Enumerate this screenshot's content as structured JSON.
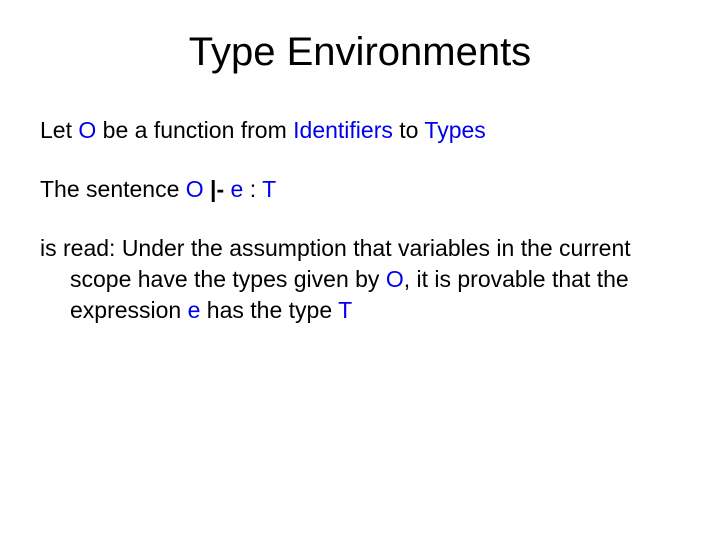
{
  "title": "Type Environments",
  "line1": {
    "t1": "Let ",
    "O": "O",
    "t2": " be a function from ",
    "ident": "Identifiers",
    "t3": " to ",
    "types": "Types"
  },
  "line2": {
    "t1": "The sentence ",
    "O": "O",
    "turnstile": " |- ",
    "e": "e",
    "colon": " : ",
    "T": "T"
  },
  "line3": {
    "t1": "is read: Under the assumption that variables in the current scope have the types given by ",
    "O": "O",
    "t2": ", it is provable that the expression ",
    "e": "e",
    "t3": " has the type ",
    "T": "T"
  }
}
